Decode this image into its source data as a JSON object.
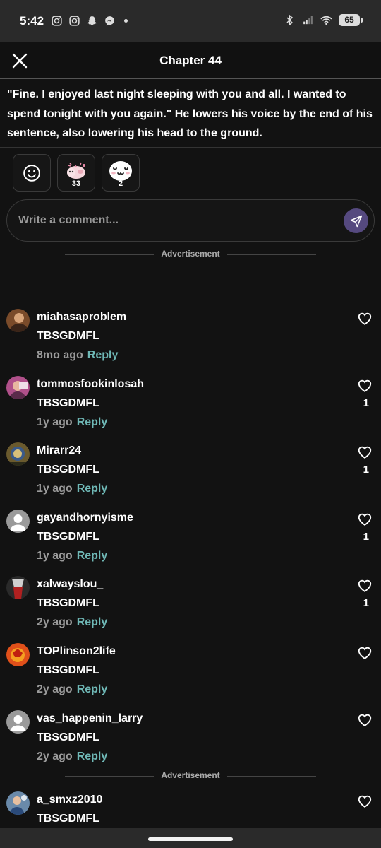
{
  "status_bar": {
    "time": "5:42",
    "battery": "65",
    "icons_left": [
      "instagram-icon",
      "instagram-icon",
      "snapchat-icon",
      "messenger-icon"
    ],
    "icons_right": [
      "bluetooth-icon",
      "signal-icon",
      "wifi-icon",
      "battery-icon"
    ]
  },
  "header": {
    "title": "Chapter 44",
    "close_icon": "close-icon"
  },
  "excerpt": {
    "text": "\"Fine. I enjoyed last night sleeping with you and all. I wanted to spend tonight with you again.\" He lowers his voice by the end of his sentence, also lowering his head to the ground."
  },
  "reactions": [
    {
      "icon": "add-reaction-icon",
      "count": ""
    },
    {
      "icon": "pink-creature-sticker",
      "count": "33"
    },
    {
      "icon": "uwu-face-sticker",
      "count": "2"
    }
  ],
  "comment_input": {
    "placeholder": "Write a comment...",
    "send_icon": "send-icon"
  },
  "advertisement_label": "Advertisement",
  "comments": [
    {
      "username": "miahasaproblem",
      "text": "TBSGDMFL",
      "time": "8mo ago",
      "reply": "Reply",
      "likes": "",
      "avatar_color": "#7a4b2a"
    },
    {
      "username": "tommosfookinlosah",
      "text": "TBSGDMFL",
      "time": "1y ago",
      "reply": "Reply",
      "likes": "1",
      "avatar_color": "#b0508a"
    },
    {
      "username": "Mirarr24",
      "text": "TBSGDMFL",
      "time": "1y ago",
      "reply": "Reply",
      "likes": "1",
      "avatar_color": "#6a5a2e"
    },
    {
      "username": "gayandhornyisme",
      "text": "TBSGDMFL",
      "time": "1y ago",
      "reply": "Reply",
      "likes": "1",
      "avatar_color": "#9a9a9a"
    },
    {
      "username": "xalwayslou_",
      "text": "TBSGDMFL",
      "time": "2y ago",
      "reply": "Reply",
      "likes": "1",
      "avatar_color": "#3a3a3a"
    },
    {
      "username": "TOPlinson2life",
      "text": "TBSGDMFL",
      "time": "2y ago",
      "reply": "Reply",
      "likes": "",
      "avatar_color": "#e0501a"
    },
    {
      "username": "vas_happenin_larry",
      "text": "TBSGDMFL",
      "time": "2y ago",
      "reply": "Reply",
      "likes": "",
      "avatar_color": "#9a9a9a"
    },
    {
      "username": "a_smxz2010",
      "text": "TBSGDMFL",
      "time": "",
      "reply": "",
      "likes": "",
      "avatar_color": "#6a8aaa"
    }
  ],
  "colors": {
    "accent_reply": "#6fb8b6",
    "send_button": "#55497f",
    "background": "#121212"
  }
}
